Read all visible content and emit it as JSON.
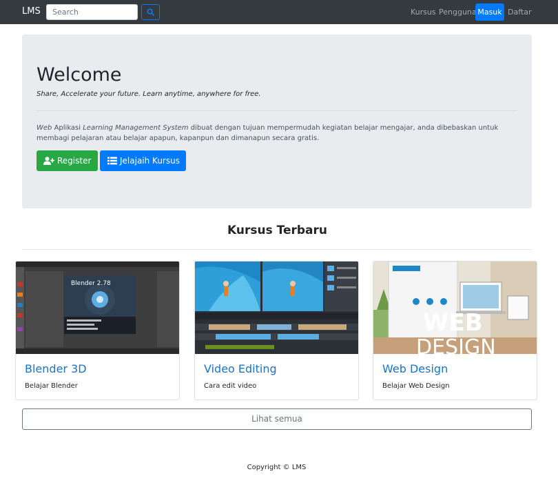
{
  "navbar": {
    "brand": "LMS",
    "search_placeholder": "Search",
    "links": [
      {
        "label": "Kursus"
      },
      {
        "label": "Pengguna"
      },
      {
        "label": "Masuk"
      },
      {
        "label": "Daftar"
      }
    ]
  },
  "hero": {
    "title": "Welcome",
    "lead": "Share, Accelerate your future. Learn anytime, anywhere for free.",
    "desc_em1": "Web",
    "desc_t1": " Aplikasi ",
    "desc_em2": "Learning Management System",
    "desc_t2": " dibuat dengan tujuan mempermudah kegiatan belajar mengajar, anda dibebaskan untuk membagi pelajaran atau belajar apapun, kapanpun dan dimanapun secara gratis.",
    "register_label": "Register",
    "explore_label": "Jelajaih Kursus"
  },
  "courses": {
    "heading": "Kursus Terbaru",
    "items": [
      {
        "title": "Blender 3D",
        "text": "Belajar Blender",
        "thumb_text": "Blender 2.78"
      },
      {
        "title": "Video Editing",
        "text": "Cara edit video"
      },
      {
        "title": "Web Design",
        "text": "Belajar Web Design",
        "thumb_text": "WEB",
        "thumb_text2": "DESIGN"
      }
    ],
    "see_all": "Lihat semua"
  },
  "footer": "Copyright © LMS",
  "colors": {
    "navbar_bg": "#343a40",
    "primary": "#007bff",
    "success": "#28a745",
    "jumbotron_bg": "#e9ecef",
    "card_title": "#1a73c7"
  },
  "icons": [
    "search-icon",
    "user-plus-icon",
    "list-icon"
  ]
}
